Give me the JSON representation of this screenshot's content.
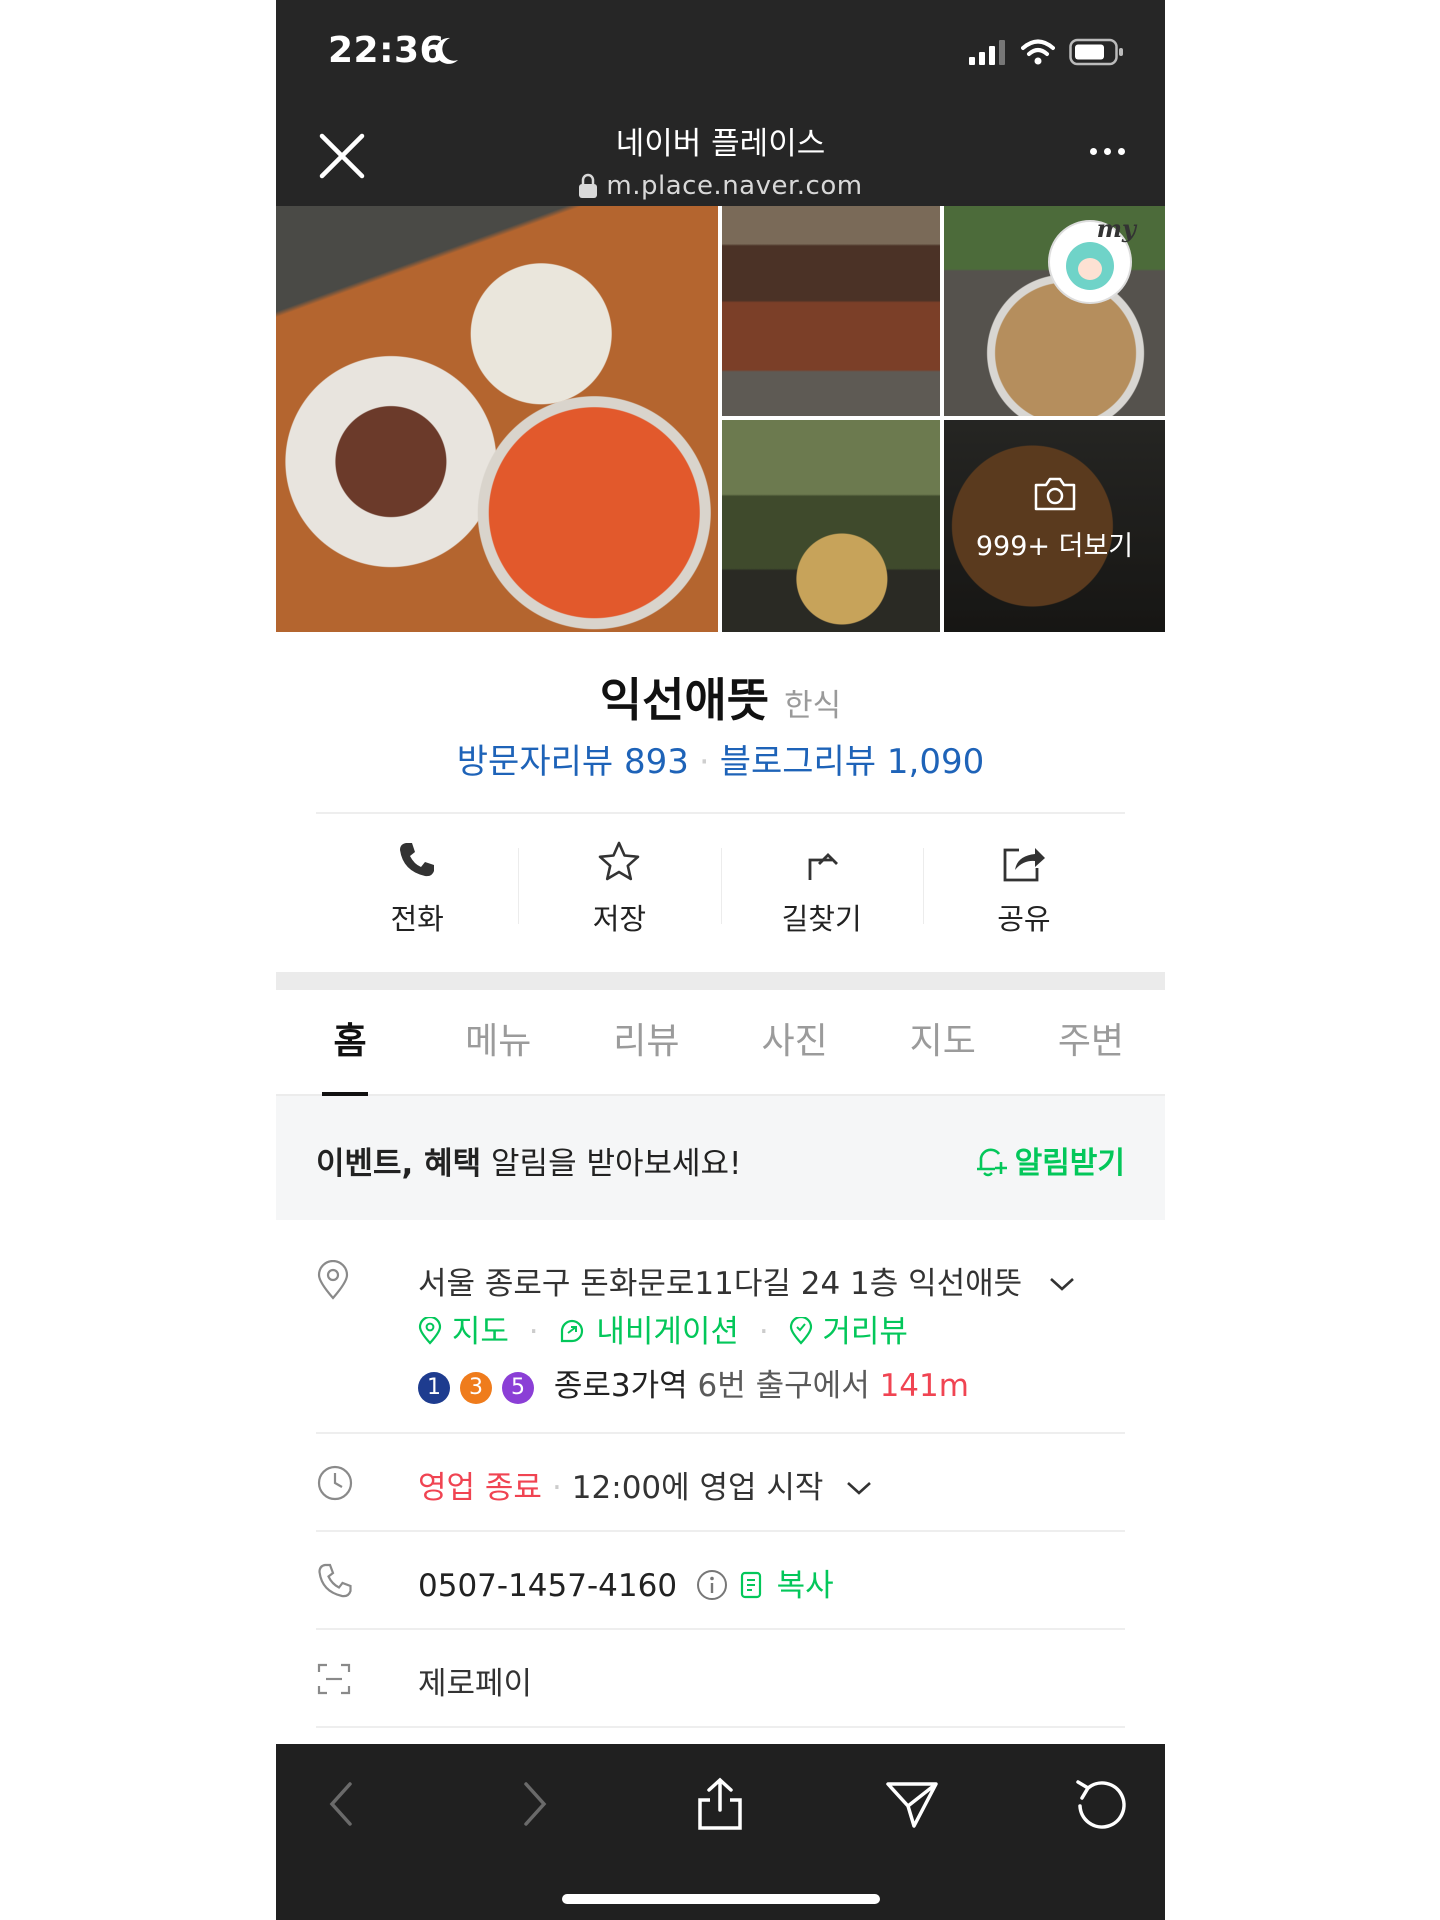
{
  "status_bar": {
    "time": "22:36"
  },
  "browser": {
    "title": "네이버 플레이스",
    "url": "m.place.naver.com"
  },
  "photos": {
    "more_label": "999+ 더보기",
    "badge_text": "my"
  },
  "place": {
    "name": "익선애뜻",
    "category": "한식",
    "visitor_reviews": "방문자리뷰 893",
    "blog_reviews": "블로그리뷰 1,090"
  },
  "actions": [
    {
      "label": "전화",
      "icon": "phone-icon"
    },
    {
      "label": "저장",
      "icon": "star-icon"
    },
    {
      "label": "길찾기",
      "icon": "directions-icon"
    },
    {
      "label": "공유",
      "icon": "share-icon"
    }
  ],
  "tabs": [
    "홈",
    "메뉴",
    "리뷰",
    "사진",
    "지도",
    "주변"
  ],
  "notice": {
    "bold_text": "이벤트, 혜택",
    "text": " 알림을 받아보세요!",
    "action": "알림받기"
  },
  "address": {
    "text": "서울 종로구 돈화문로11다길 24 1층 익선애뜻",
    "map": "지도",
    "navigation": "내비게이션",
    "street_view": "거리뷰",
    "subway_lines": [
      {
        "num": "1",
        "color": "#1e3c8f"
      },
      {
        "num": "3",
        "color": "#ef7c1c"
      },
      {
        "num": "5",
        "color": "#8b3fd6"
      }
    ],
    "station": "종로3가역",
    "exit_text": "6번 출구에서",
    "distance": "141m"
  },
  "hours": {
    "status": "영업 종료",
    "next": "12:00에 영업 시작"
  },
  "phone": {
    "number": "0507-1457-4160",
    "copy": "복사"
  },
  "payment": {
    "label": "제로페이"
  },
  "colors": {
    "naver_green": "#03c75a",
    "link_blue": "#1e63b8",
    "closed_red": "#f04452"
  }
}
